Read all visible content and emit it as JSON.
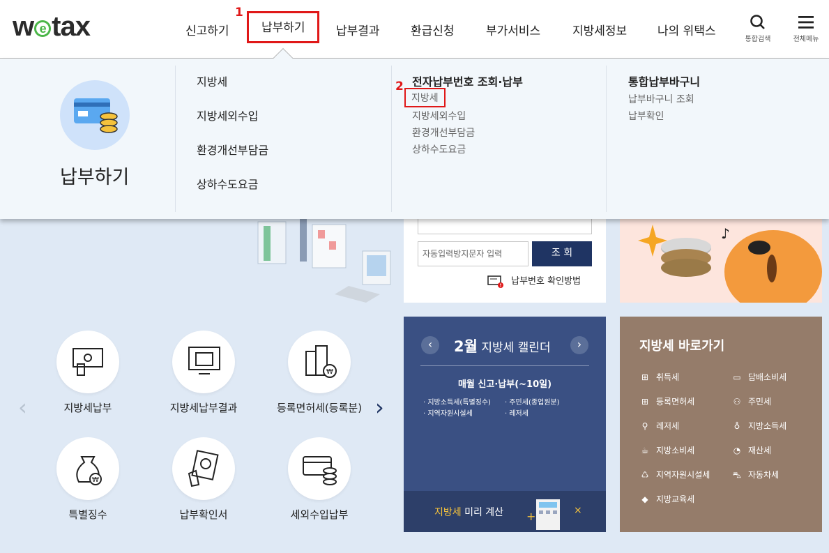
{
  "logo": {
    "pre": "w",
    "e": "e",
    "post": "tax"
  },
  "nav": [
    "신고하기",
    "납부하기",
    "납부결과",
    "환급신청",
    "부가서비스",
    "지방세정보",
    "나의 위택스"
  ],
  "markers": {
    "one": "1",
    "two": "2"
  },
  "header_icons": {
    "search": "통합검색",
    "menu": "전체메뉴"
  },
  "mega": {
    "title": "납부하기",
    "col1": [
      "지방세",
      "지방세외수입",
      "환경개선부담금",
      "상하수도요금"
    ],
    "col2_head": "전자납부번호 조회·납부",
    "col2": [
      "지방세",
      "지방세외수입",
      "환경개선부담금",
      "상하수도요금"
    ],
    "col3_head": "통합납부바구니",
    "col3": [
      "납부바구니 조회",
      "납부확인"
    ]
  },
  "lookup": {
    "placeholder": "자동입력방지문자 입력",
    "button": "조 회",
    "help": "납부번호 확인방법"
  },
  "quick": [
    "지방세납부",
    "지방세납부결과",
    "등록면허세(등록분)",
    "특별징수",
    "납부확인서",
    "세외수입납부"
  ],
  "calendar": {
    "month": "2월",
    "title": "지방세 캘린더",
    "sub": "매월 신고·납부(~10일)",
    "items": [
      "지방소득세(특별징수)",
      "주민세(종업원분)",
      "지역자원시설세",
      "레저세"
    ],
    "footer_hl": "지방세",
    "footer": " 미리 계산"
  },
  "shortcut": {
    "title": "지방세 바로가기",
    "items": [
      "취득세",
      "담배소비세",
      "등록면허세",
      "주민세",
      "레저세",
      "지방소득세",
      "지방소비세",
      "재산세",
      "지역자원시설세",
      "자동차세",
      "지방교육세"
    ]
  },
  "colors": {
    "navy": "#1f3463",
    "red": "#e01818",
    "green": "#4bb648",
    "brown": "#957c6a",
    "calendar": "#3a5083"
  }
}
